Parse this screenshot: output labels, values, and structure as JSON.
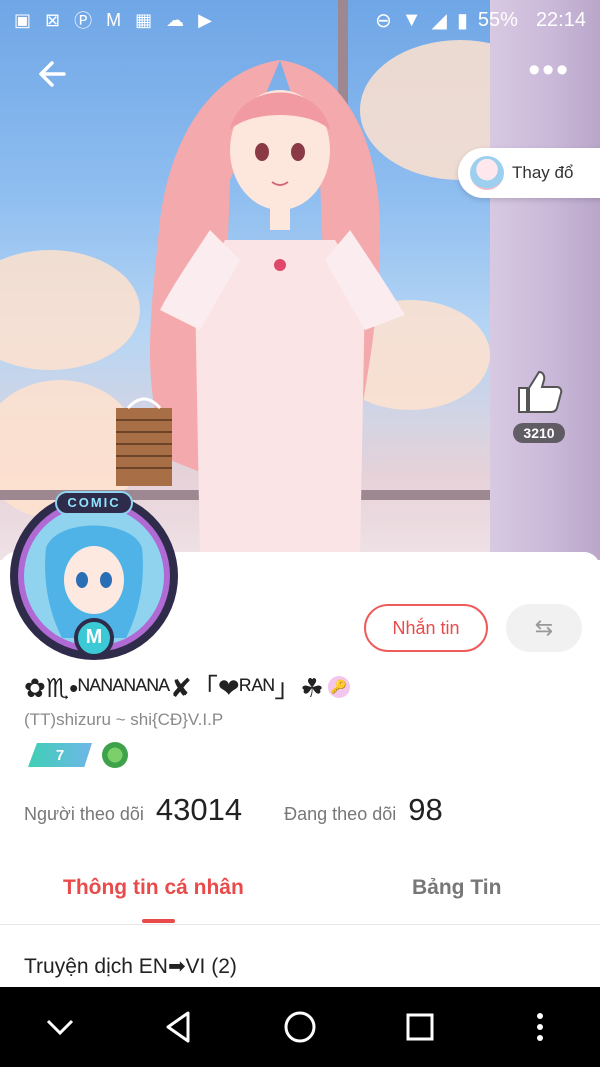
{
  "status_bar": {
    "time": "22:14",
    "battery": "55%"
  },
  "hero": {
    "change_outfit_label": "Thay đổ",
    "like_count": "3210",
    "avatar_frame_text": "COMIC",
    "avatar_letter": "M"
  },
  "profile": {
    "username": "✿♏•ᴺᴬᴺᴬᴺᴬᴺᴬ✘「❤ᴿᴬᴺ」☘",
    "key_badge": "🔑",
    "handle": "(TT)shizuru ~ shi{CĐ}V.I.P",
    "level": "7",
    "message_button": "Nhắn tin",
    "switch_icon": "⇆",
    "followers_label": "Người theo dõi",
    "followers_value": "43014",
    "following_label": "Đang theo dõi",
    "following_value": "98"
  },
  "tabs": {
    "active": "Thông tin cá nhân",
    "inactive": "Bảng Tin"
  },
  "section": {
    "title": "Truyện dịch EN➡VI (2)"
  },
  "colors": {
    "accent": "#e94b4b",
    "sky": "#8fbef0",
    "hair": "#f3a9a9"
  },
  "icons": {
    "back": "back-arrow-icon",
    "more": "more-dots-icon",
    "like": "thumbs-up-icon",
    "nav": [
      "collapse-icon",
      "back-triangle-icon",
      "home-circle-icon",
      "recents-square-icon",
      "overflow-dots-icon"
    ]
  }
}
